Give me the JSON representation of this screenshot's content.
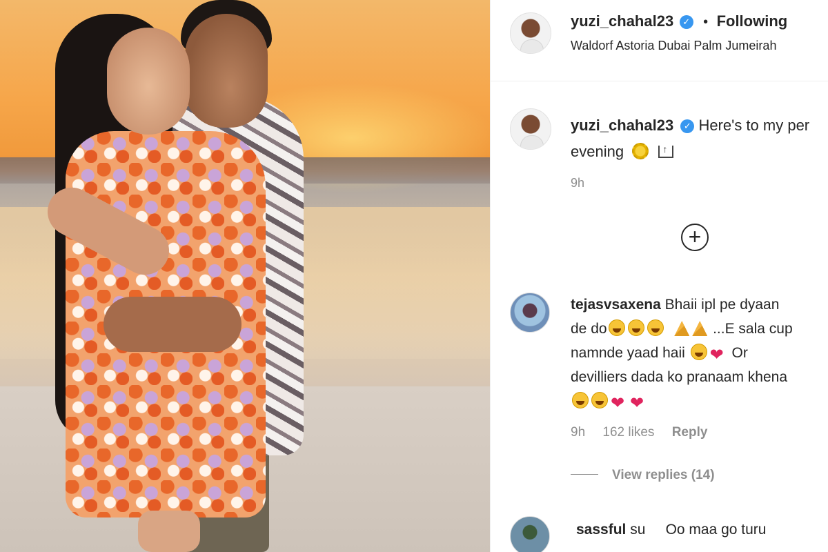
{
  "header": {
    "username": "yuzi_chahal23",
    "verified_badge": "✓",
    "separator": "•",
    "follow_status": "Following",
    "location": "Waldorf Astoria Dubai Palm Jumeirah"
  },
  "caption": {
    "username": "yuzi_chahal23",
    "text_line1": "Here's to my per",
    "text_line2": "evening",
    "time": "9h"
  },
  "load_more": {
    "icon": "+"
  },
  "comments": [
    {
      "username": "tejasvsaxena",
      "line1": "Bhaii ipl pe dyaan",
      "line2_a": "de do",
      "line2_b": "...E sala cup",
      "line3_a": "namnde yaad haii",
      "line3_b": "Or",
      "line4": "devilliers dada ko pranaam khena",
      "time": "9h",
      "likes": "162 likes",
      "reply": "Reply",
      "view_replies": "View replies (14)"
    },
    {
      "username": "sassful",
      "text": "su     Oo maa go turu"
    }
  ],
  "icons": {
    "verified": "verified-badge-icon",
    "sun": "sun-emoji-icon",
    "upload": "upload-emoji-icon",
    "plus": "plus-circle-icon",
    "laugh": "laughing-emoji-icon",
    "pray": "folded-hands-emoji-icon",
    "heart": "heart-emoji-icon"
  },
  "colors": {
    "text": "#262626",
    "muted": "#8e8e8e",
    "verified": "#3897f0",
    "border": "#efefef"
  }
}
